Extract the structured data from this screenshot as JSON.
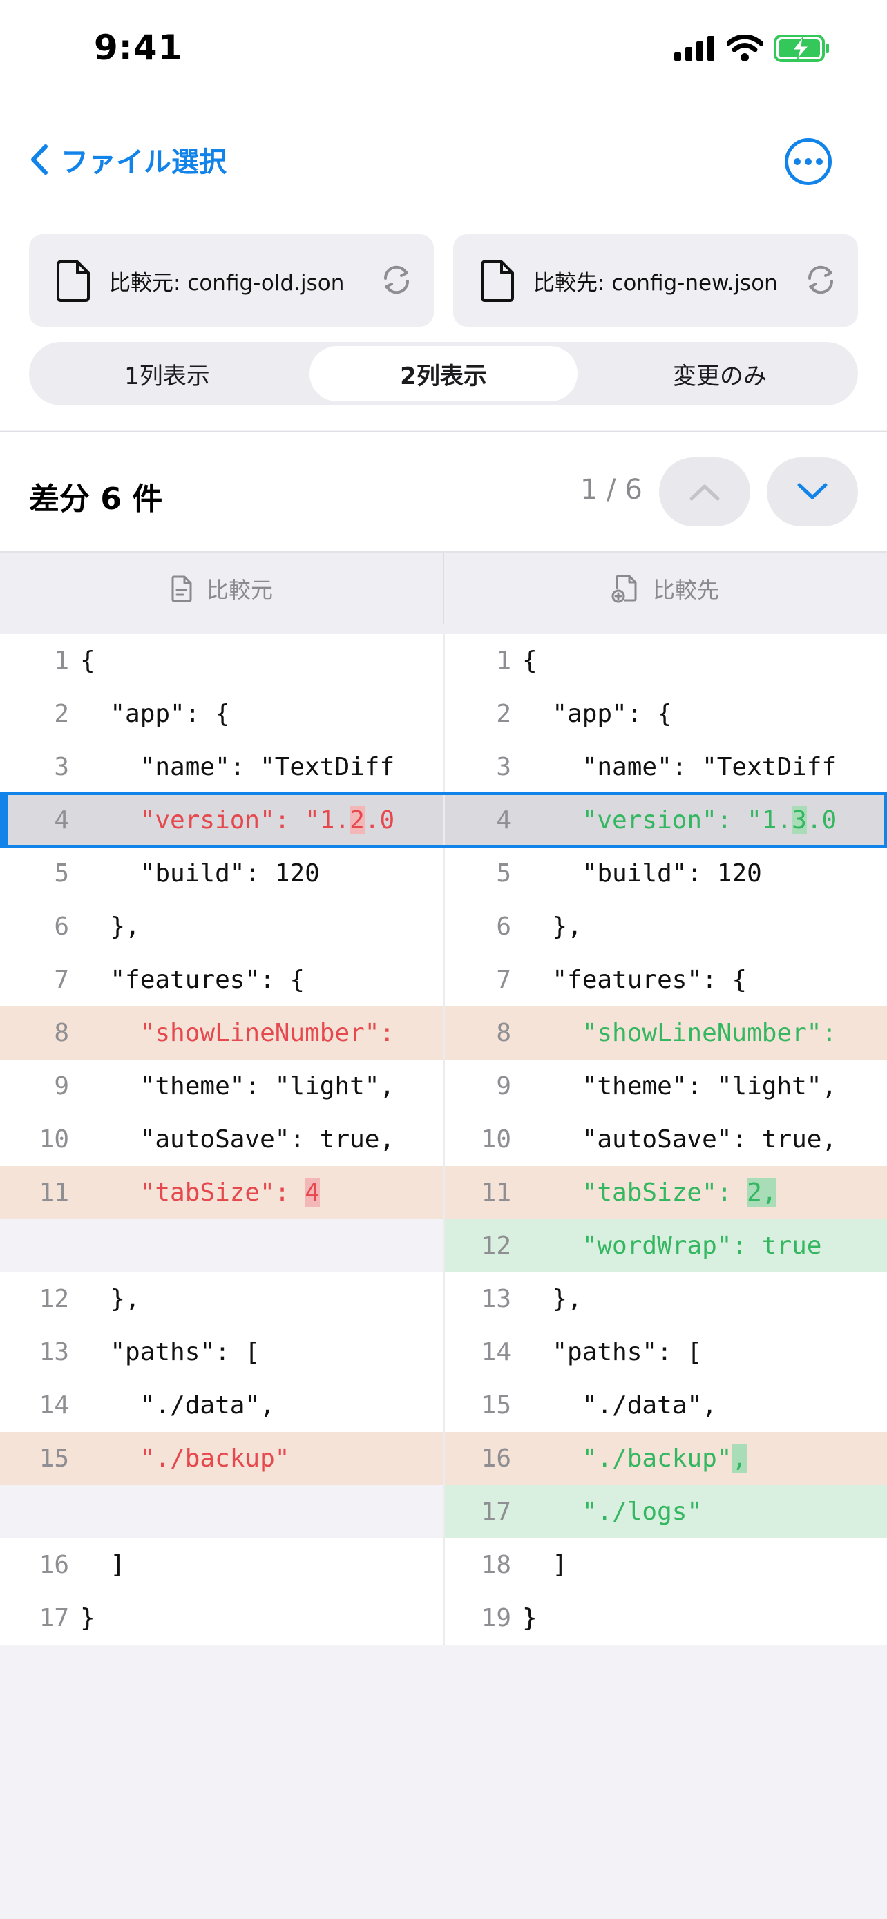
{
  "status": {
    "time": "9:41"
  },
  "nav": {
    "back_label": "ファイル選択"
  },
  "files": {
    "left": "比較元: config-old.json",
    "right": "比較先: config-new.json"
  },
  "segments": [
    "1列表示",
    "2列表示",
    "変更のみ"
  ],
  "active_segment": 1,
  "diff": {
    "title": "差分 6 件",
    "counter": "1 / 6"
  },
  "columns": {
    "left": "比較元",
    "right": "比較先"
  },
  "colors": {
    "accent": "#1283E8",
    "deleted": "#E5484D",
    "added": "#34B760"
  },
  "left_lines": [
    {
      "n": "1",
      "t": "{",
      "s": ""
    },
    {
      "n": "2",
      "t": "  \"app\": {",
      "s": ""
    },
    {
      "n": "3",
      "t": "    \"name\": \"TextDiff",
      "s": ""
    },
    {
      "n": "4",
      "t": "    \"version\": \"1.",
      "h": "2",
      "a": ".0",
      "s": "sel"
    },
    {
      "n": "5",
      "t": "    \"build\": 120",
      "s": ""
    },
    {
      "n": "6",
      "t": "  },",
      "s": ""
    },
    {
      "n": "7",
      "t": "  \"features\": {",
      "s": ""
    },
    {
      "n": "8",
      "t": "    \"showLineNumber\":",
      "s": "mod"
    },
    {
      "n": "9",
      "t": "    \"theme\": \"light\",",
      "s": ""
    },
    {
      "n": "10",
      "t": "    \"autoSave\": true,",
      "s": ""
    },
    {
      "n": "11",
      "t": "    \"tabSize\": ",
      "h": "4",
      "a": "",
      "s": "mod"
    },
    {
      "n": "",
      "t": "",
      "s": "blank"
    },
    {
      "n": "12",
      "t": "  },",
      "s": ""
    },
    {
      "n": "13",
      "t": "  \"paths\": [",
      "s": ""
    },
    {
      "n": "14",
      "t": "    \"./data\",",
      "s": ""
    },
    {
      "n": "15",
      "t": "    \"./backup\"",
      "s": "mod"
    },
    {
      "n": "",
      "t": "",
      "s": "blank"
    },
    {
      "n": "16",
      "t": "  ]",
      "s": ""
    },
    {
      "n": "17",
      "t": "}",
      "s": ""
    }
  ],
  "right_lines": [
    {
      "n": "1",
      "t": "{",
      "s": ""
    },
    {
      "n": "2",
      "t": "  \"app\": {",
      "s": ""
    },
    {
      "n": "3",
      "t": "    \"name\": \"TextDiff",
      "s": ""
    },
    {
      "n": "4",
      "t": "    \"version\": \"1.",
      "h": "3",
      "a": ".0",
      "s": "sel"
    },
    {
      "n": "5",
      "t": "    \"build\": 120",
      "s": ""
    },
    {
      "n": "6",
      "t": "  },",
      "s": ""
    },
    {
      "n": "7",
      "t": "  \"features\": {",
      "s": ""
    },
    {
      "n": "8",
      "t": "    \"showLineNumber\":",
      "s": "mod"
    },
    {
      "n": "9",
      "t": "    \"theme\": \"light\",",
      "s": ""
    },
    {
      "n": "10",
      "t": "    \"autoSave\": true,",
      "s": ""
    },
    {
      "n": "11",
      "t": "    \"tabSize\": ",
      "h": "2,",
      "a": "",
      "s": "mod"
    },
    {
      "n": "12",
      "t": "    \"wordWrap\": true",
      "s": "add"
    },
    {
      "n": "13",
      "t": "  },",
      "s": ""
    },
    {
      "n": "14",
      "t": "  \"paths\": [",
      "s": ""
    },
    {
      "n": "15",
      "t": "    \"./data\",",
      "s": ""
    },
    {
      "n": "16",
      "t": "    \"./backup\"",
      "h": ",",
      "a": "",
      "s": "mod"
    },
    {
      "n": "17",
      "t": "    \"./logs\"",
      "s": "add"
    },
    {
      "n": "18",
      "t": "  ]",
      "s": ""
    },
    {
      "n": "19",
      "t": "}",
      "s": ""
    }
  ]
}
